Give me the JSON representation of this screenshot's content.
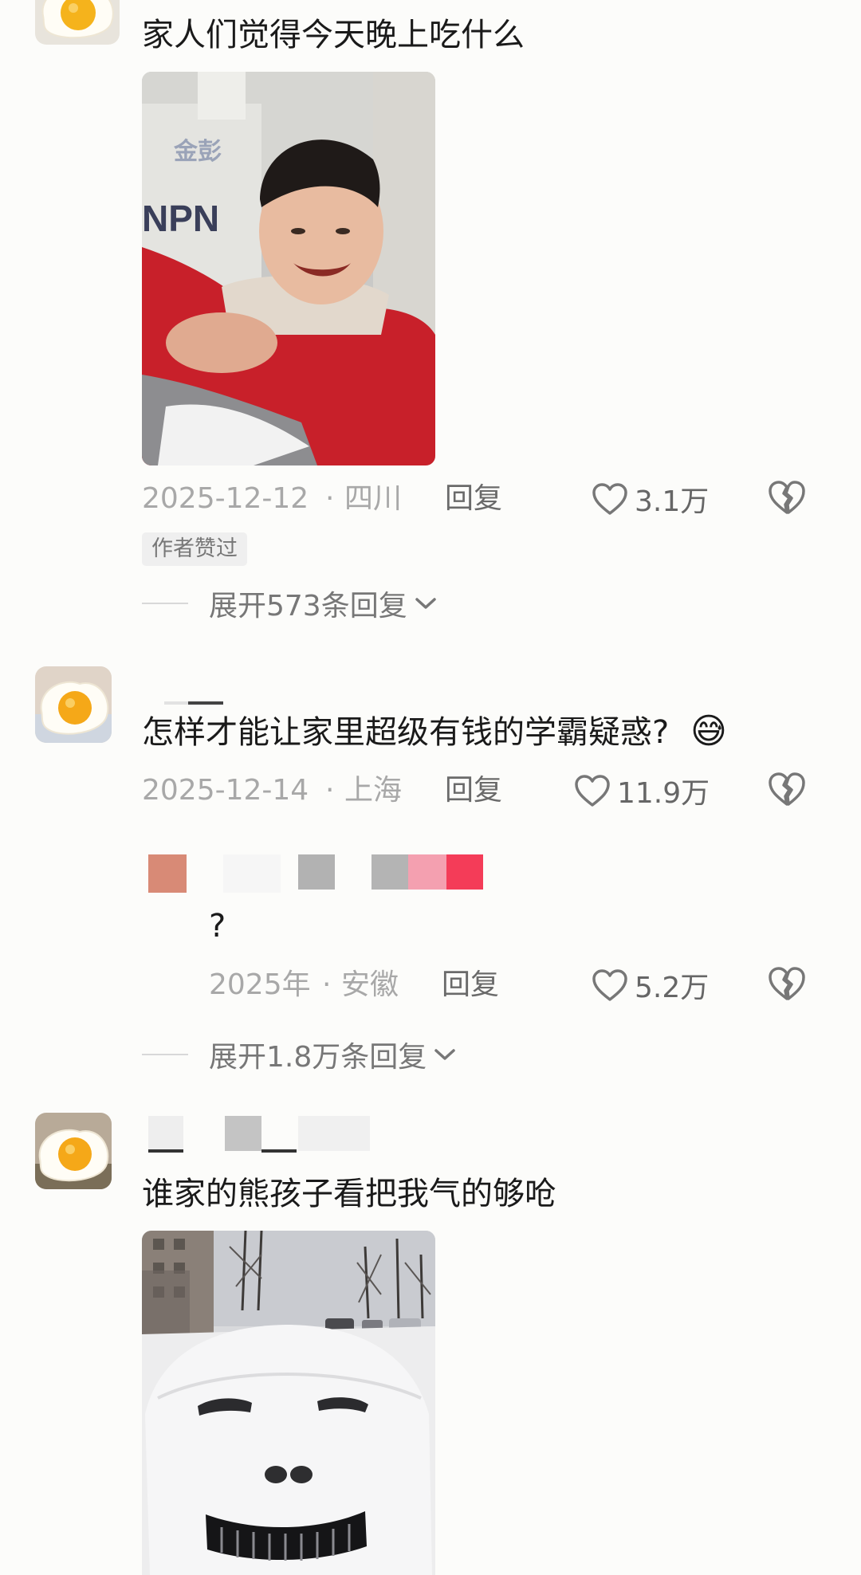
{
  "comments": [
    {
      "avatar": "fried-egg-avatar",
      "text": "家人们觉得今天晚上吃什么",
      "image": "photo-boy-in-red-jacket",
      "date": "2025-12-12",
      "location": "四川",
      "reply_label": "回复",
      "likes": "3.1万",
      "author_liked": "作者赞过",
      "expand_label": "展开573条回复"
    },
    {
      "avatar": "fried-egg-avatar",
      "text": "怎样才能让家里超级有钱的学霸疑惑?",
      "emoji": "😅",
      "date": "2025-12-14",
      "location": "上海",
      "reply_label": "回复",
      "likes": "11.9万",
      "sub_reply": {
        "text": "?",
        "date": "2025年",
        "location": "安徽",
        "reply_label": "回复",
        "likes": "5.2万"
      },
      "expand_label": "展开1.8万条回复"
    },
    {
      "avatar": "fried-egg-avatar",
      "text": "谁家的熊孩子看把我气的够呛",
      "image": "photo-snow-covered-car-face"
    }
  ],
  "separator": "·",
  "colors": {
    "background": "#fcfcfa",
    "meta_text": "#a8a8a8",
    "jacket_red": "#c8202a"
  }
}
